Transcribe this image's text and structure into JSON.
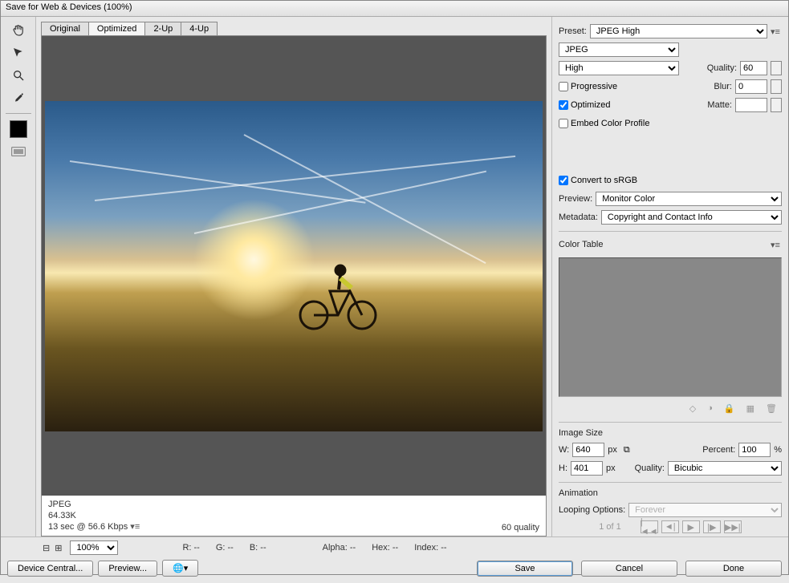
{
  "title": "Save for Web & Devices (100%)",
  "tabs": {
    "original": "Original",
    "optimized": "Optimized",
    "twoup": "2-Up",
    "fourup": "4-Up"
  },
  "status": {
    "format": "JPEG",
    "size": "64.33K",
    "time": "13 sec @ 56.6 Kbps",
    "quality": "60 quality"
  },
  "preset": {
    "label": "Preset:",
    "value": "JPEG High"
  },
  "format": {
    "value": "JPEG"
  },
  "quality_sel": {
    "value": "High",
    "quality_label": "Quality:",
    "quality_value": "60"
  },
  "progressive": {
    "label": "Progressive",
    "blur_label": "Blur:",
    "blur_value": "0"
  },
  "optimized": {
    "label": "Optimized",
    "matte_label": "Matte:"
  },
  "embed": {
    "label": "Embed Color Profile"
  },
  "convert": {
    "label": "Convert to sRGB"
  },
  "preview": {
    "label": "Preview:",
    "value": "Monitor Color"
  },
  "metadata": {
    "label": "Metadata:",
    "value": "Copyright and Contact Info"
  },
  "color_table": {
    "label": "Color Table"
  },
  "image_size": {
    "label": "Image Size",
    "w_label": "W:",
    "w_value": "640",
    "h_label": "H:",
    "h_value": "401",
    "px": "px",
    "percent_label": "Percent:",
    "percent_value": "100",
    "percent_unit": "%",
    "quality_label": "Quality:",
    "quality_value": "Bicubic"
  },
  "animation": {
    "label": "Animation",
    "loop_label": "Looping Options:",
    "loop_value": "Forever",
    "counter": "1 of 1"
  },
  "info": {
    "r": "R: --",
    "g": "G: --",
    "b": "B: --",
    "alpha": "Alpha: --",
    "hex": "Hex: --",
    "index": "Index: --",
    "zoom": "100%"
  },
  "buttons": {
    "device": "Device Central...",
    "preview": "Preview...",
    "save": "Save",
    "cancel": "Cancel",
    "done": "Done"
  }
}
